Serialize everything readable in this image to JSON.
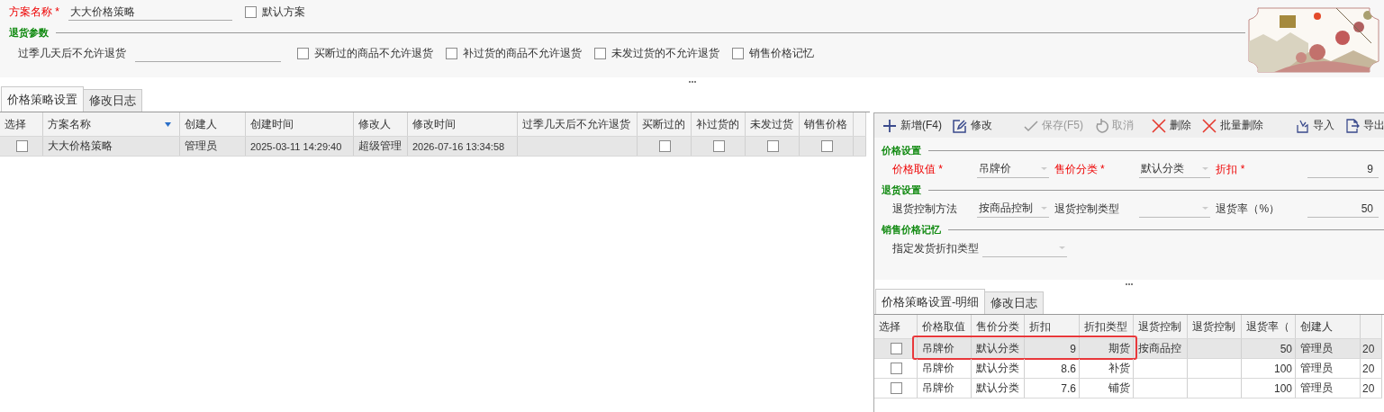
{
  "scheme": {
    "label": "方案名称",
    "mark": "*",
    "value": "大大价格策略",
    "default_option": {
      "label": "默认方案",
      "checked": false
    }
  },
  "return_params": {
    "title": "退货参数",
    "days_label": "过季几天后不允许退货",
    "options": [
      {
        "label": "买断过的商品不允许退货",
        "checked": false
      },
      {
        "label": "补过货的商品不允许退货",
        "checked": false
      },
      {
        "label": "未发过货的不允许退货",
        "checked": false
      },
      {
        "label": "销售价格记忆",
        "checked": false
      }
    ]
  },
  "main_tabs": [
    {
      "label": "价格策略设置",
      "selected": true
    },
    {
      "label": "修改日志",
      "selected": false
    }
  ],
  "grid": {
    "columns": [
      {
        "label": "选择",
        "kind": "check"
      },
      {
        "label": "方案名称",
        "kind": "text",
        "filter": true
      },
      {
        "label": "创建人",
        "kind": "text"
      },
      {
        "label": "创建时间",
        "kind": "small"
      },
      {
        "label": "修改人",
        "kind": "text"
      },
      {
        "label": "修改时间",
        "kind": "small"
      },
      {
        "label": "过季几天后不允许退货",
        "kind": "text"
      },
      {
        "label": "买断过的",
        "kind": "check"
      },
      {
        "label": "补过货的",
        "kind": "check"
      },
      {
        "label": "未发过货",
        "kind": "check"
      },
      {
        "label": "销售价格",
        "kind": "check"
      },
      {
        "kind": "cut"
      }
    ],
    "rows": [
      {
        "selected": true,
        "cells": [
          {
            "checked": false
          },
          "大大价格策略",
          "管理员",
          "2025-03-11 14:29:40",
          "超级管理",
          "2026-07-16 13:34:58",
          null,
          {
            "checked": false
          },
          {
            "checked": false
          },
          {
            "checked": false
          },
          {
            "checked": false
          },
          null
        ]
      }
    ]
  },
  "toolbar": [
    {
      "kind": "plus",
      "label": "新增(F4)",
      "disabled": false
    },
    {
      "kind": "edit",
      "label": "修改",
      "disabled": false
    },
    {
      "kind": "separator"
    },
    {
      "kind": "check",
      "label": "保存(F5)",
      "disabled": true
    },
    {
      "kind": "undo",
      "label": "取消",
      "disabled": true
    },
    {
      "kind": "separator"
    },
    {
      "kind": "cross",
      "label": "删除",
      "disabled": false
    },
    {
      "kind": "cross",
      "label": "批量删除",
      "disabled": false
    },
    {
      "kind": "separator"
    },
    {
      "kind": "import",
      "label": "导入",
      "disabled": false
    },
    {
      "kind": "export",
      "label": "导出",
      "disabled": false
    }
  ],
  "form_sections": [
    {
      "title": "价格设置",
      "fields": [
        {
          "label": "价格取值",
          "mark": "*",
          "kind": "combo",
          "value": "吊牌价"
        },
        {
          "label": "售价分类",
          "mark": "*",
          "kind": "combo",
          "value": "默认分类"
        },
        {
          "label": "折扣",
          "mark": "*",
          "kind": "number",
          "value": "9"
        }
      ]
    },
    {
      "title": "退货设置",
      "fields": [
        {
          "label": "退货控制方法",
          "kind": "combo",
          "value": "按商品控制"
        },
        {
          "label": "退货控制类型",
          "kind": "combo"
        },
        {
          "label": "退货率（%）",
          "kind": "number",
          "value": "50"
        }
      ]
    },
    {
      "title": "销售价格记忆",
      "fields": [
        {
          "label": "指定发货折扣类型",
          "kind": "combo"
        }
      ]
    }
  ],
  "detail_tabs": [
    {
      "label": "价格策略设置-明细",
      "selected": true
    },
    {
      "label": "修改日志",
      "selected": false
    }
  ],
  "detail_grid": {
    "columns": [
      {
        "label": "选择",
        "kind": "check"
      },
      {
        "label": "价格取值",
        "kind": "text"
      },
      {
        "label": "售价分类",
        "kind": "text"
      },
      {
        "label": "折扣",
        "kind": "num"
      },
      {
        "label": "折扣类型",
        "kind": "num"
      },
      {
        "label": "退货控制",
        "kind": "text"
      },
      {
        "label": "退货控制",
        "kind": "text"
      },
      {
        "label": "退货率（",
        "kind": "num"
      },
      {
        "label": "创建人",
        "kind": "text"
      },
      {
        "kind": "cut"
      }
    ],
    "rows": [
      {
        "selected": true,
        "highlighted": true,
        "cells": [
          {
            "checked": false
          },
          "吊牌价",
          "默认分类",
          "9",
          "期货",
          "按商品控",
          null,
          "50",
          "管理员",
          "20"
        ]
      },
      {
        "selected": false,
        "highlighted": false,
        "cells": [
          {
            "checked": false
          },
          "吊牌价",
          "默认分类",
          "8.6",
          "补货",
          null,
          null,
          "100",
          "管理员",
          "20"
        ]
      },
      {
        "selected": false,
        "highlighted": false,
        "cells": [
          {
            "checked": false
          },
          "吊牌价",
          "默认分类",
          "7.6",
          "铺货",
          null,
          null,
          "100",
          "管理员",
          "20"
        ]
      }
    ]
  }
}
